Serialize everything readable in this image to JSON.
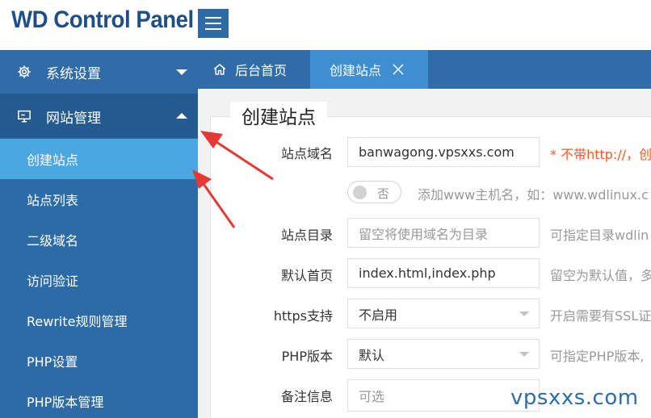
{
  "app": {
    "title": "WD Control Panel"
  },
  "sidebar": {
    "groups": [
      {
        "label": "系统设置",
        "icon": "gear-icon",
        "expanded": false
      },
      {
        "label": "网站管理",
        "icon": "monitor-icon",
        "expanded": true
      }
    ],
    "items": [
      {
        "label": "创建站点",
        "active": true
      },
      {
        "label": "站点列表",
        "active": false
      },
      {
        "label": "二级域名",
        "active": false
      },
      {
        "label": "访问验证",
        "active": false
      },
      {
        "label": "Rewrite规则管理",
        "active": false
      },
      {
        "label": "PHP设置",
        "active": false
      },
      {
        "label": "PHP版本管理",
        "active": false
      }
    ]
  },
  "tabs": [
    {
      "label": "后台首页",
      "icon": "home-icon",
      "active": false
    },
    {
      "label": "创建站点",
      "active": true,
      "closable": true
    }
  ],
  "form": {
    "legend": "创建站点",
    "domain": {
      "label": "站点域名",
      "value": "banwagong.vpsxxs.com",
      "hint": "* 不带http://，创"
    },
    "www_switch": {
      "state": "否",
      "hint": "添加www主机名，如：www.wdlinux.c"
    },
    "directory": {
      "label": "站点目录",
      "placeholder": "留空将使用域名为目录",
      "hint": "可指定目录wdlin"
    },
    "index": {
      "label": "默认首页",
      "value": "index.html,index.php",
      "hint": "留空为默认值，多"
    },
    "https": {
      "label": "https支持",
      "selected": "不启用",
      "hint": "开启需要有SSL证"
    },
    "php_version": {
      "label": "PHP版本",
      "selected": "默认",
      "hint": "可指定PHP版本,"
    },
    "note": {
      "label": "备注信息",
      "placeholder": "可选"
    }
  },
  "watermark": "vpsxxs.com",
  "colors": {
    "brand": "#1f4f86",
    "sidebar": "#2d6ba6",
    "active_item": "#4aa7e2",
    "active_tab": "#3e8ed0",
    "required_hint": "#ff5722",
    "annotation_arrow": "#e53935"
  }
}
